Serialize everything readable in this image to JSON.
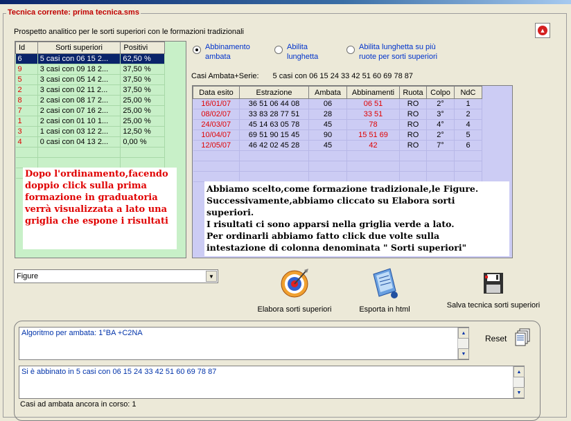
{
  "frame": {
    "title": "Tecnica corrente: prima tecnica.sms"
  },
  "prospetto": "Prospetto analitico per le sorti superiori con le formazioni tradizionali",
  "left_grid": {
    "headers": [
      "Id",
      "Sorti superiori",
      "Positivi"
    ],
    "rows": [
      [
        "6",
        "5 casi con 06 15 2...",
        "62,50 %"
      ],
      [
        "9",
        "3 casi con 09 18 2...",
        "37,50 %"
      ],
      [
        "5",
        "3 casi con 05 14 2...",
        "37,50 %"
      ],
      [
        "2",
        "3 casi con 02 11 2...",
        "37,50 %"
      ],
      [
        "8",
        "2 casi con 08 17 2...",
        "25,00 %"
      ],
      [
        "7",
        "2 casi con 07 16 2...",
        "25,00 %"
      ],
      [
        "1",
        "2 casi con 01 10 1...",
        "25,00 %"
      ],
      [
        "3",
        "1 casi con 03 12 2...",
        "12,50 %"
      ],
      [
        "4",
        "0 casi con 04 13 2...",
        "0,00 %"
      ]
    ]
  },
  "note_left": "Dopo l'ordinamento,facendo doppio click sulla prima formazione in graduatoria verrà visualizzata a lato una griglia che espone i risultati",
  "radios": [
    {
      "label1": "Abbinamento",
      "label2": "ambata",
      "checked": true
    },
    {
      "label1": "Abilita",
      "label2": "lunghetta",
      "checked": false
    },
    {
      "label1": "Abilita lunghetta su più",
      "label2": "ruote per sorti superiori",
      "checked": false
    }
  ],
  "casi": {
    "label": "Casi Ambata+Serie:",
    "value": "5 casi con 06 15 24 33 42 51 60 69 78 87"
  },
  "right_grid": {
    "headers": [
      "Data esito",
      "Estrazione",
      "Ambata",
      "Abbinamenti",
      "Ruota",
      "Colpo",
      "NdC"
    ],
    "rows": [
      [
        "16/01/07",
        "36 51 06 44 08",
        "06",
        "06 51",
        "RO",
        "2°",
        "1"
      ],
      [
        "08/02/07",
        "33 83 28 77 51",
        "28",
        "33 51",
        "RO",
        "3°",
        "2"
      ],
      [
        "24/03/07",
        "45 14 63 05 78",
        "45",
        "78",
        "RO",
        "4°",
        "4"
      ],
      [
        "10/04/07",
        "69 51 90 15 45",
        "90",
        "15 51 69",
        "RO",
        "2°",
        "5"
      ],
      [
        "12/05/07",
        "46 42 02 45 28",
        "45",
        "42",
        "RO",
        "7°",
        "6"
      ]
    ]
  },
  "note_right": [
    "Abbiamo scelto,come formazione tradizionale,le Figure.",
    "Successivamente,abbiamo cliccato su Elabora sorti",
    "superiori.",
    "I risultati ci sono apparsi nella griglia verde a lato.",
    "Per ordinarli abbiamo fatto click due volte sulla",
    "intestazione di colonna denominata \" Sorti superiori\""
  ],
  "select": {
    "value": "Figure"
  },
  "tools": {
    "elabora": "Elabora sorti superiori",
    "esporta": "Esporta in html",
    "salva": "Salva tecnica sorti superiori"
  },
  "reset": "Reset",
  "algoritmo": "Algoritmo per ambata: 1°BA +C2NA",
  "abbinato": "Si è abbinato in 5 casi con 06 15 24 33 42 51 60 69 78 87",
  "in_corso": "Casi ad ambata ancora in corso:  1",
  "colors": {
    "accent_red": "#e00000",
    "green_grid": "#c8f0c8",
    "blue_grid": "#ccccf4",
    "selection": "#0a246a"
  }
}
